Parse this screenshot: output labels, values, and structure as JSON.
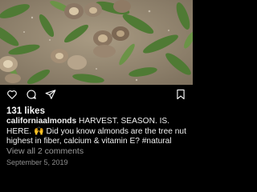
{
  "post": {
    "image_alt": "almonds on the ground",
    "likes": "131 likes",
    "username": "californiaalmonds",
    "caption_text": " HARVEST. SEASON. IS. HERE. 🙌 Did you know almonds are the tree nut highest in fiber, calcium & vitamin E? #natural",
    "view_comments": "View all 2 comments",
    "date": "September 5, 2019"
  },
  "icons": {
    "like": "heart-icon",
    "comment": "comment-bubble-icon",
    "share": "paper-plane-icon",
    "save": "bookmark-icon"
  },
  "colors": {
    "background": "#000000",
    "text": "#f5f5f5",
    "muted": "#8e8e8e"
  }
}
